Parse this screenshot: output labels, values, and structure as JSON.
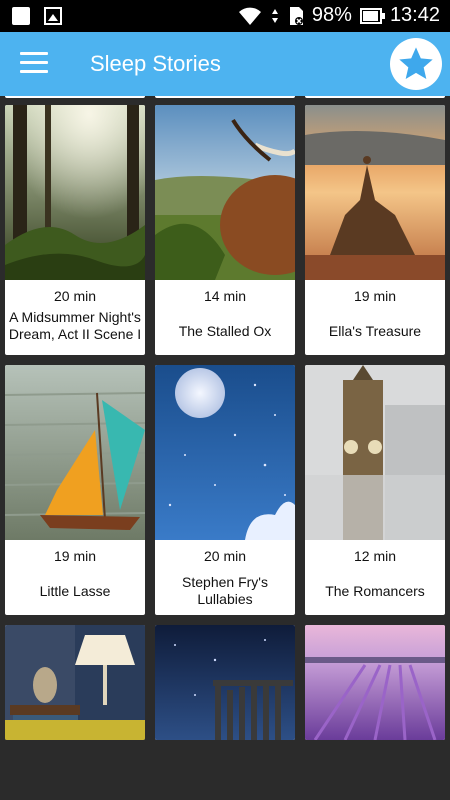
{
  "status": {
    "battery": "98%",
    "time": "13:42"
  },
  "appbar": {
    "title": "Sleep Stories"
  },
  "stories": [
    {
      "duration": "20 min",
      "title": "A Midsummer Night's Dream, Act II Scene I"
    },
    {
      "duration": "14 min",
      "title": "The Stalled Ox"
    },
    {
      "duration": "19 min",
      "title": "Ella's Treasure"
    },
    {
      "duration": "19 min",
      "title": "Little Lasse"
    },
    {
      "duration": "20 min",
      "title": "Stephen Fry's Lullabies"
    },
    {
      "duration": "12 min",
      "title": "The Romancers"
    }
  ],
  "colors": {
    "appbar": "#4db3f0",
    "star": "#3ea8ec",
    "background": "#2b2b2b"
  }
}
